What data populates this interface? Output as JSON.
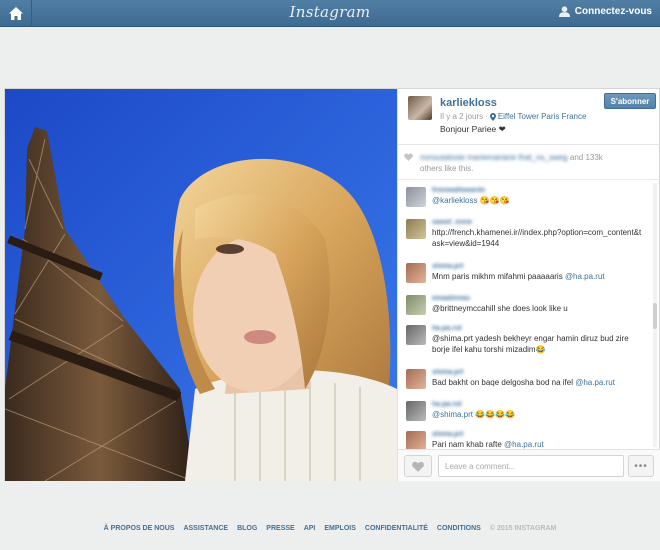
{
  "topbar": {
    "logo": "Instagram",
    "login_label": "Connectez-vous"
  },
  "post": {
    "username": "karliekloss",
    "time": "Il y a 2 jours",
    "location": "Eiffel Tower Paris France",
    "caption": "Bonjour Pariee ❤",
    "follow_label": "S'abonner"
  },
  "likes": {
    "names": "nonsutalosie mariemariarie that_ns_sweg",
    "count_text": "and 133k",
    "others_text": "others like this."
  },
  "comments": [
    {
      "user": "frionwallowards",
      "text": "@karliekloss 😘😘😘",
      "mention": ""
    },
    {
      "user": "sweet_irene",
      "text": "http://french.khamenei.ir//index.php?option=com_content&task=view&id=1944",
      "mention": ""
    },
    {
      "user": "shima.prt",
      "text": "Mnm paris mikhm mifahmi paaaaaris ",
      "mention": "@ha.pa.rut"
    },
    {
      "user": "emaalinnas",
      "text": "@brittneymccahill she does look like u",
      "mention": ""
    },
    {
      "user": "ha.pa.rut",
      "text": "@shima.prt yadesh bekheyr engar hamin diruz bud zire borje ifel kahu torshi mizadim😂",
      "mention": ""
    },
    {
      "user": "shima.prt",
      "text": "Bad bakht on baqe delgosha bod na ifel ",
      "mention": "@ha.pa.rut"
    },
    {
      "user": "ha.pa.rut",
      "text": "@shima.prt 😂😂😂😂",
      "mention": ""
    },
    {
      "user": "shima.prt",
      "text": "Pari nam khab rafte ",
      "mention": "@ha.pa.rut"
    }
  ],
  "comment_box": {
    "placeholder": "Leave a comment...",
    "more_label": "•••"
  },
  "footer": {
    "links": [
      "À PROPOS DE NOUS",
      "ASSISTANCE",
      "BLOG",
      "PRESSE",
      "API",
      "EMPLOIS",
      "CONFIDENTIALITÉ",
      "CONDITIONS"
    ],
    "copyright": "© 2015 INSTAGRAM"
  },
  "icons": {
    "home": "home-icon",
    "user": "user-icon",
    "location": "location-pin-icon",
    "heart": "heart-icon",
    "more": "more-icon"
  },
  "colors": {
    "brand_blue": "#3f729b",
    "topbar": "#517fa4",
    "background": "#edeeee"
  }
}
